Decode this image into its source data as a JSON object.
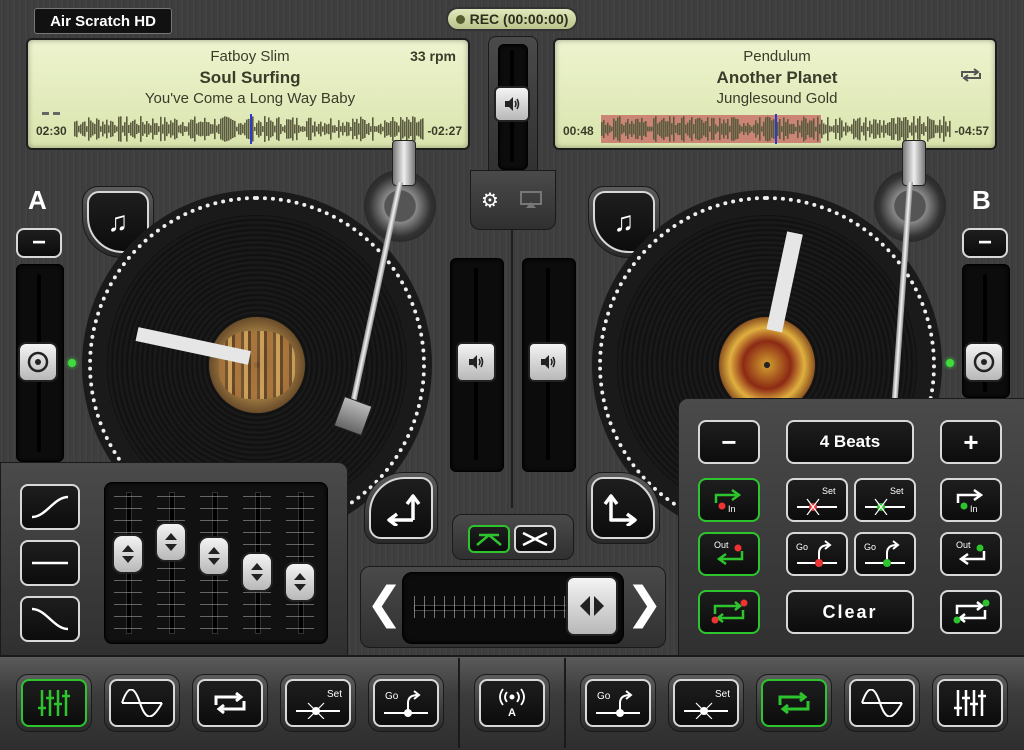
{
  "app": {
    "title": "Air Scratch HD"
  },
  "rec": {
    "label": "REC (00:00:00)"
  },
  "deck_a": {
    "letter": "A",
    "artist": "Fatboy Slim",
    "title": "Soul Surfing",
    "album": "You've Come a Long Way Baby",
    "rpm": "33 rpm",
    "elapsed": "02:30",
    "remaining": "-02:27",
    "pitch_minus": "−"
  },
  "deck_b": {
    "letter": "B",
    "artist": "Pendulum",
    "title": "Another Planet",
    "album": "Junglesound Gold",
    "elapsed": "00:48",
    "remaining": "-04:57",
    "pitch_minus": "−"
  },
  "loop_panel": {
    "minus": "−",
    "beats": "4 Beats",
    "plus": "+",
    "in_label": "In",
    "out_label": "Out",
    "set_label": "Set",
    "go_label": "Go",
    "clear": "Clear"
  },
  "bottom_bar": {
    "set_label": "Set",
    "go_label": "Go",
    "auto_label": "A"
  },
  "colors": {
    "accent_green": "#2ec42e",
    "lcd_bg": "#e4ecbe",
    "waveform": "#5a5a3c",
    "loop_region": "#c0504d"
  }
}
